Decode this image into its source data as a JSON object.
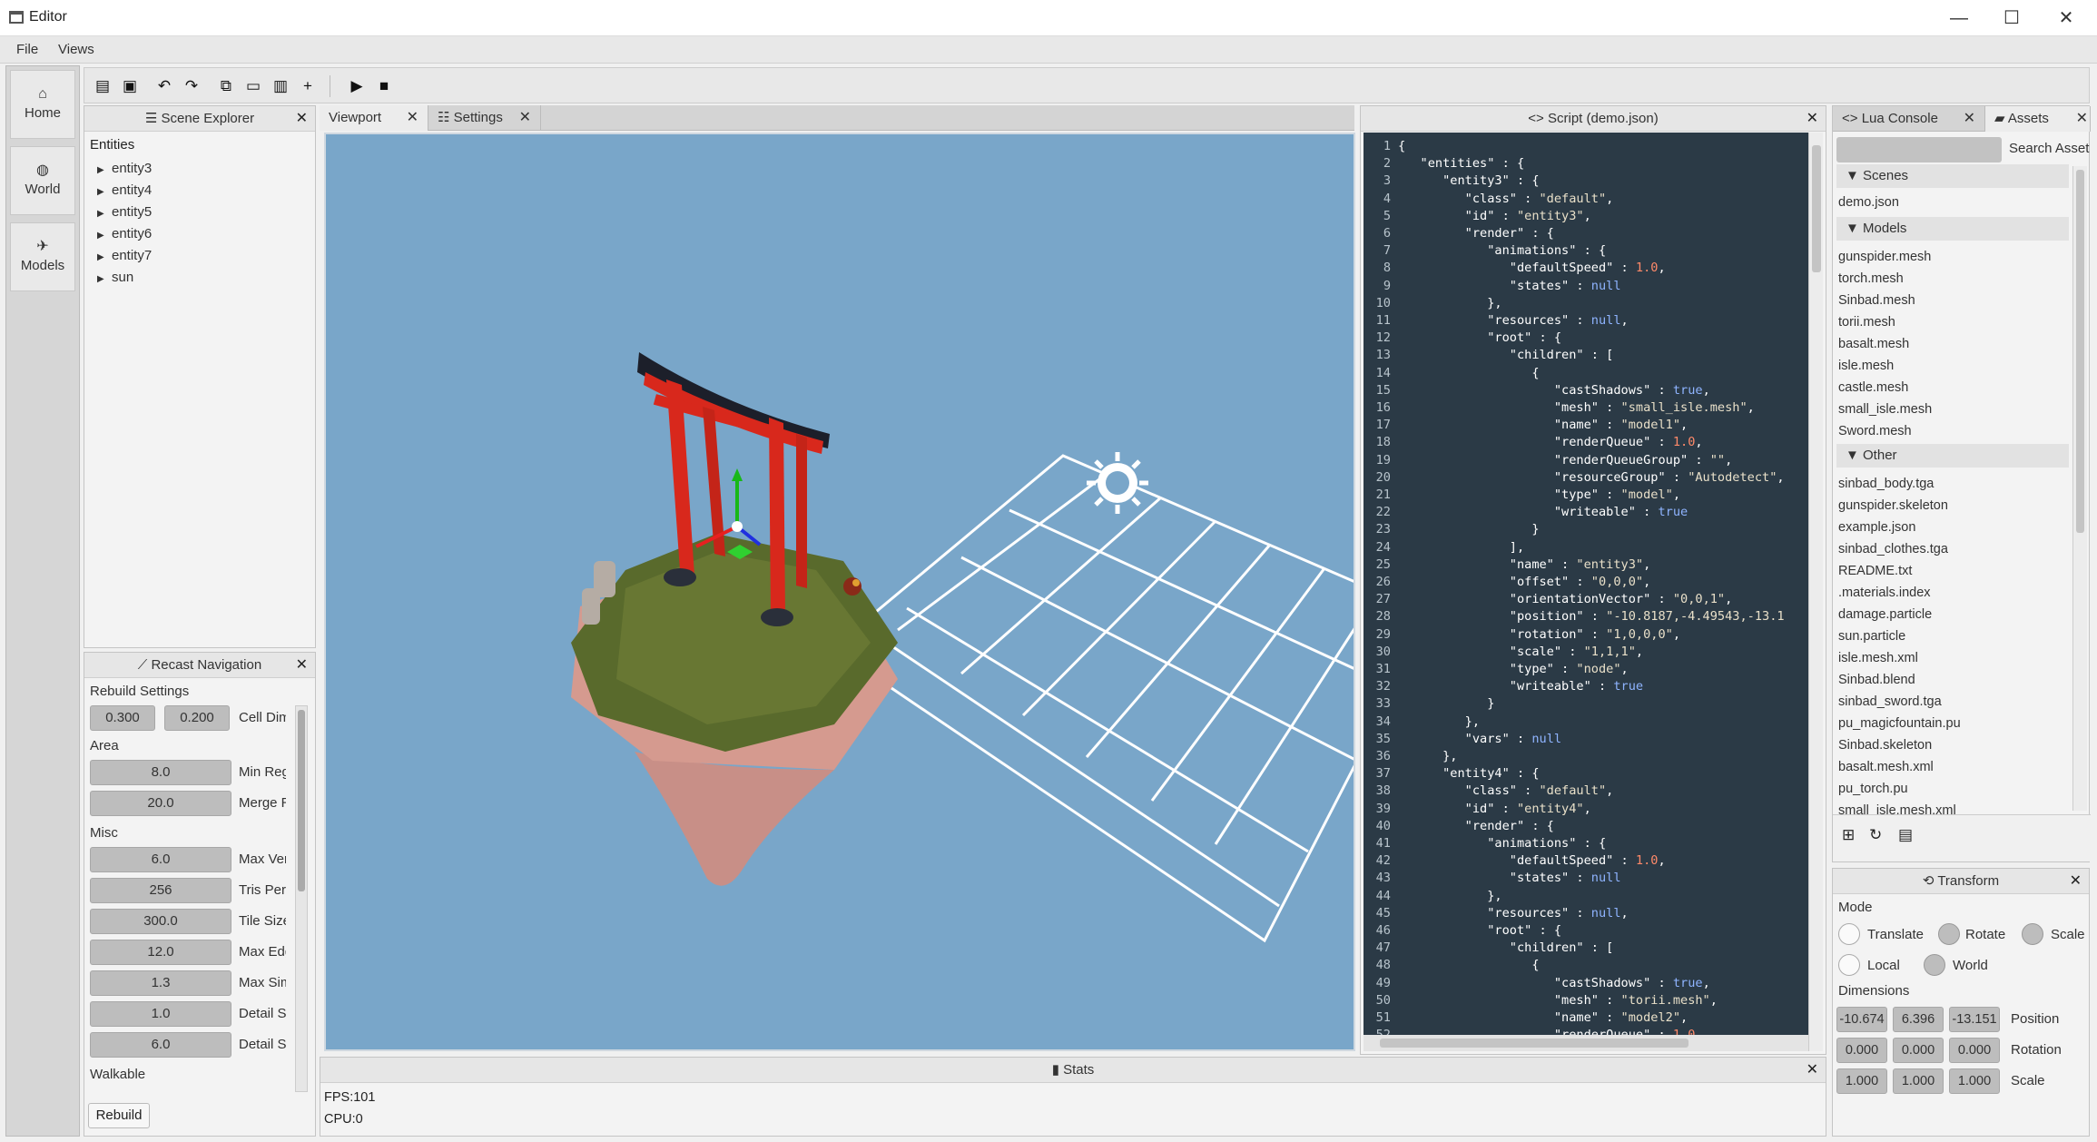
{
  "window": {
    "title": "Editor",
    "minimize": "—",
    "maximize": "☐",
    "close": "✕"
  },
  "menu": {
    "file": "File",
    "views": "Views"
  },
  "sidebar": {
    "home": {
      "label": "Home",
      "icon": "home-icon"
    },
    "world": {
      "label": "World",
      "icon": "globe-icon"
    },
    "models": {
      "label": "Models",
      "icon": "runner-icon"
    }
  },
  "toolbar": {
    "icons": [
      "new-file-icon",
      "save-icon",
      "undo-icon",
      "redo-icon",
      "copy-icon",
      "paste-icon",
      "delete-icon",
      "add-icon",
      "play-icon",
      "stop-icon"
    ]
  },
  "scene_explorer": {
    "title": "Scene Explorer",
    "header": "Entities",
    "items": [
      "entity3",
      "entity4",
      "entity5",
      "entity6",
      "entity7",
      "sun"
    ]
  },
  "recast": {
    "title": "Recast Navigation",
    "rebuild_settings": "Rebuild Settings",
    "cell_a": "0.300",
    "cell_b": "0.200",
    "cell_label": "Cell Dime",
    "area": "Area",
    "min_region": "8.0",
    "min_region_label": "Min Regi",
    "merge_region": "20.0",
    "merge_region_label": "Merge Re",
    "misc": "Misc",
    "max_verts": "6.0",
    "max_verts_label": "Max Vert",
    "tris_per": "256",
    "tris_per_label": "Tris Per C",
    "tile_size": "300.0",
    "tile_size_label": "Tile Size",
    "max_edge": "12.0",
    "max_edge_label": "Max Edge",
    "max_simp": "1.3",
    "max_simp_label": "Max Simp",
    "detail_a": "1.0",
    "detail_a_label": "Detail Sa",
    "detail_b": "6.0",
    "detail_b_label": "Detail Sa",
    "walkable": "Walkable",
    "rebuild": "Rebuild"
  },
  "tabs": {
    "viewport": "Viewport",
    "settings": "Settings"
  },
  "script": {
    "title": "Script (demo.json)",
    "lines": [
      [
        {
          "t": "{",
          "c": "kv"
        }
      ],
      [
        {
          "t": "   \"entities\" : {",
          "c": "kv"
        }
      ],
      [
        {
          "t": "      \"entity3\" : {",
          "c": "kv"
        }
      ],
      [
        {
          "t": "         \"class\" : ",
          "c": "kv"
        },
        {
          "t": "\"default\"",
          "c": "str"
        },
        {
          "t": ",",
          "c": "kv"
        }
      ],
      [
        {
          "t": "         \"id\" : ",
          "c": "kv"
        },
        {
          "t": "\"entity3\"",
          "c": "str"
        },
        {
          "t": ",",
          "c": "kv"
        }
      ],
      [
        {
          "t": "         \"render\" : {",
          "c": "kv"
        }
      ],
      [
        {
          "t": "            \"animations\" : {",
          "c": "kv"
        }
      ],
      [
        {
          "t": "               \"defaultSpeed\" : ",
          "c": "kv"
        },
        {
          "t": "1.0",
          "c": "num"
        },
        {
          "t": ",",
          "c": "kv"
        }
      ],
      [
        {
          "t": "               \"states\" : ",
          "c": "kv"
        },
        {
          "t": "null",
          "c": "kw"
        }
      ],
      [
        {
          "t": "            },",
          "c": "kv"
        }
      ],
      [
        {
          "t": "            \"resources\" : ",
          "c": "kv"
        },
        {
          "t": "null",
          "c": "kw"
        },
        {
          "t": ",",
          "c": "kv"
        }
      ],
      [
        {
          "t": "            \"root\" : {",
          "c": "kv"
        }
      ],
      [
        {
          "t": "               \"children\" : [",
          "c": "kv"
        }
      ],
      [
        {
          "t": "                  {",
          "c": "kv"
        }
      ],
      [
        {
          "t": "                     \"castShadows\" : ",
          "c": "kv"
        },
        {
          "t": "true",
          "c": "kw"
        },
        {
          "t": ",",
          "c": "kv"
        }
      ],
      [
        {
          "t": "                     \"mesh\" : ",
          "c": "kv"
        },
        {
          "t": "\"small_isle.mesh\"",
          "c": "str"
        },
        {
          "t": ",",
          "c": "kv"
        }
      ],
      [
        {
          "t": "                     \"name\" : ",
          "c": "kv"
        },
        {
          "t": "\"model1\"",
          "c": "str"
        },
        {
          "t": ",",
          "c": "kv"
        }
      ],
      [
        {
          "t": "                     \"renderQueue\" : ",
          "c": "kv"
        },
        {
          "t": "1.0",
          "c": "num"
        },
        {
          "t": ",",
          "c": "kv"
        }
      ],
      [
        {
          "t": "                     \"renderQueueGroup\" : ",
          "c": "kv"
        },
        {
          "t": "\"\"",
          "c": "str"
        },
        {
          "t": ",",
          "c": "kv"
        }
      ],
      [
        {
          "t": "                     \"resourceGroup\" : ",
          "c": "kv"
        },
        {
          "t": "\"Autodetect\"",
          "c": "str"
        },
        {
          "t": ",",
          "c": "kv"
        }
      ],
      [
        {
          "t": "                     \"type\" : ",
          "c": "kv"
        },
        {
          "t": "\"model\"",
          "c": "str"
        },
        {
          "t": ",",
          "c": "kv"
        }
      ],
      [
        {
          "t": "                     \"writeable\" : ",
          "c": "kv"
        },
        {
          "t": "true",
          "c": "kw"
        }
      ],
      [
        {
          "t": "                  }",
          "c": "kv"
        }
      ],
      [
        {
          "t": "               ],",
          "c": "kv"
        }
      ],
      [
        {
          "t": "               \"name\" : ",
          "c": "kv"
        },
        {
          "t": "\"entity3\"",
          "c": "str"
        },
        {
          "t": ",",
          "c": "kv"
        }
      ],
      [
        {
          "t": "               \"offset\" : ",
          "c": "kv"
        },
        {
          "t": "\"0,0,0\"",
          "c": "str"
        },
        {
          "t": ",",
          "c": "kv"
        }
      ],
      [
        {
          "t": "               \"orientationVector\" : ",
          "c": "kv"
        },
        {
          "t": "\"0,0,1\"",
          "c": "str"
        },
        {
          "t": ",",
          "c": "kv"
        }
      ],
      [
        {
          "t": "               \"position\" : ",
          "c": "kv"
        },
        {
          "t": "\"-10.8187,-4.49543,-13.1",
          "c": "str"
        }
      ],
      [
        {
          "t": "               \"rotation\" : ",
          "c": "kv"
        },
        {
          "t": "\"1,0,0,0\"",
          "c": "str"
        },
        {
          "t": ",",
          "c": "kv"
        }
      ],
      [
        {
          "t": "               \"scale\" : ",
          "c": "kv"
        },
        {
          "t": "\"1,1,1\"",
          "c": "str"
        },
        {
          "t": ",",
          "c": "kv"
        }
      ],
      [
        {
          "t": "               \"type\" : ",
          "c": "kv"
        },
        {
          "t": "\"node\"",
          "c": "str"
        },
        {
          "t": ",",
          "c": "kv"
        }
      ],
      [
        {
          "t": "               \"writeable\" : ",
          "c": "kv"
        },
        {
          "t": "true",
          "c": "kw"
        }
      ],
      [
        {
          "t": "            }",
          "c": "kv"
        }
      ],
      [
        {
          "t": "         },",
          "c": "kv"
        }
      ],
      [
        {
          "t": "         \"vars\" : ",
          "c": "kv"
        },
        {
          "t": "null",
          "c": "kw"
        }
      ],
      [
        {
          "t": "      },",
          "c": "kv"
        }
      ],
      [
        {
          "t": "      \"entity4\" : {",
          "c": "kv"
        }
      ],
      [
        {
          "t": "         \"class\" : ",
          "c": "kv"
        },
        {
          "t": "\"default\"",
          "c": "str"
        },
        {
          "t": ",",
          "c": "kv"
        }
      ],
      [
        {
          "t": "         \"id\" : ",
          "c": "kv"
        },
        {
          "t": "\"entity4\"",
          "c": "str"
        },
        {
          "t": ",",
          "c": "kv"
        }
      ],
      [
        {
          "t": "         \"render\" : {",
          "c": "kv"
        }
      ],
      [
        {
          "t": "            \"animations\" : {",
          "c": "kv"
        }
      ],
      [
        {
          "t": "               \"defaultSpeed\" : ",
          "c": "kv"
        },
        {
          "t": "1.0",
          "c": "num"
        },
        {
          "t": ",",
          "c": "kv"
        }
      ],
      [
        {
          "t": "               \"states\" : ",
          "c": "kv"
        },
        {
          "t": "null",
          "c": "kw"
        }
      ],
      [
        {
          "t": "            },",
          "c": "kv"
        }
      ],
      [
        {
          "t": "            \"resources\" : ",
          "c": "kv"
        },
        {
          "t": "null",
          "c": "kw"
        },
        {
          "t": ",",
          "c": "kv"
        }
      ],
      [
        {
          "t": "            \"root\" : {",
          "c": "kv"
        }
      ],
      [
        {
          "t": "               \"children\" : [",
          "c": "kv"
        }
      ],
      [
        {
          "t": "                  {",
          "c": "kv"
        }
      ],
      [
        {
          "t": "                     \"castShadows\" : ",
          "c": "kv"
        },
        {
          "t": "true",
          "c": "kw"
        },
        {
          "t": ",",
          "c": "kv"
        }
      ],
      [
        {
          "t": "                     \"mesh\" : ",
          "c": "kv"
        },
        {
          "t": "\"torii.mesh\"",
          "c": "str"
        },
        {
          "t": ",",
          "c": "kv"
        }
      ],
      [
        {
          "t": "                     \"name\" : ",
          "c": "kv"
        },
        {
          "t": "\"model2\"",
          "c": "str"
        },
        {
          "t": ",",
          "c": "kv"
        }
      ],
      [
        {
          "t": "                     \"renderQueue\" : ",
          "c": "kv"
        },
        {
          "t": "1.0",
          "c": "num"
        },
        {
          "t": ",",
          "c": "kv"
        }
      ],
      [
        {
          "t": "",
          "c": "kv"
        }
      ]
    ]
  },
  "lua_tab": "Lua Console",
  "assets": {
    "title": "Assets",
    "search_placeholder": "Search Asset",
    "scenes_label": "Scenes",
    "scenes": [
      "demo.json"
    ],
    "models_label": "Models",
    "models": [
      "gunspider.mesh",
      "torch.mesh",
      "Sinbad.mesh",
      "torii.mesh",
      "basalt.mesh",
      "isle.mesh",
      "castle.mesh",
      "small_isle.mesh",
      "Sword.mesh"
    ],
    "other_label": "Other",
    "other": [
      "sinbad_body.tga",
      "gunspider.skeleton",
      "example.json",
      "sinbad_clothes.tga",
      "README.txt",
      ".materials.index",
      "damage.particle",
      "sun.particle",
      "isle.mesh.xml",
      "Sinbad.blend",
      "sinbad_sword.tga",
      "pu_magicfountain.pu",
      "Sinbad.skeleton",
      "basalt.mesh.xml",
      "pu_torch.pu",
      "small_isle.mesh.xml"
    ]
  },
  "transform": {
    "title": "Transform",
    "mode": "Mode",
    "translate": "Translate",
    "rotate": "Rotate",
    "scale": "Scale",
    "local": "Local",
    "world": "World",
    "dimensions": "Dimensions",
    "position": [
      "-10.674",
      "6.396",
      "-13.151"
    ],
    "position_label": "Position",
    "rotation": [
      "0.000",
      "0.000",
      "0.000"
    ],
    "rotation_label": "Rotation",
    "scale_vals": [
      "1.000",
      "1.000",
      "1.000"
    ],
    "scale_label": "Scale"
  },
  "stats": {
    "title": "Stats",
    "fps": "FPS:101",
    "cpu": "CPU:0"
  },
  "colors": {
    "viewport_bg": "#79a6c9",
    "script_bg": "#2b3a46",
    "torii_red": "#d8281c",
    "grass": "#596a2c"
  }
}
